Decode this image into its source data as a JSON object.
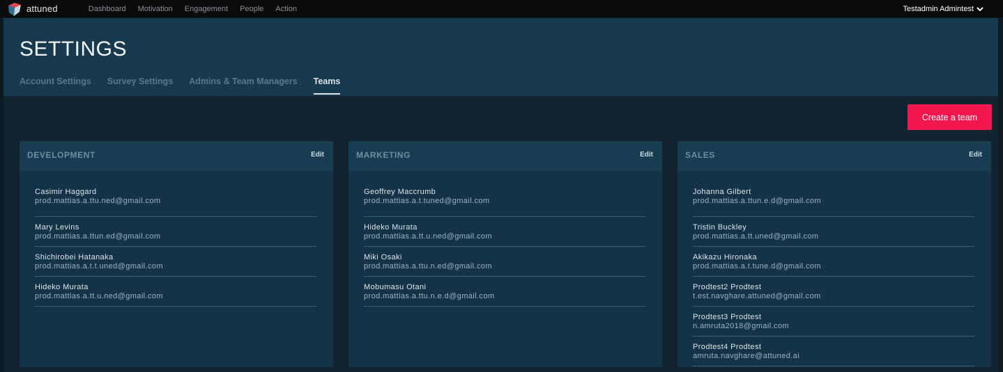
{
  "app": {
    "logo_text": "attuned"
  },
  "nav": [
    "Dashboard",
    "Motivation",
    "Engagement",
    "People",
    "Action"
  ],
  "user": {
    "name": "Testadmin Admintest"
  },
  "page": {
    "title": "SETTINGS"
  },
  "tabs": [
    "Account Settings",
    "Survey Settings",
    "Admins & Team Managers",
    "Teams"
  ],
  "active_tab": "Teams",
  "actions": {
    "create_team": "Create a team"
  },
  "edit_label": "Edit",
  "teams": [
    {
      "name": "DEVELOPMENT",
      "members": [
        {
          "name": "Casimir Haggard",
          "email": "prod.mattias.a.ttu.ned@gmail.com"
        },
        {
          "name": "Mary Levins",
          "email": "prod.mattias.a.ttun.ed@gmail.com"
        },
        {
          "name": "Shichirobei Hatanaka",
          "email": "prod.mattias.a.t.t.uned@gmail.com"
        },
        {
          "name": "Hideko Murata",
          "email": "prod.mattias.a.tt.u.ned@gmail.com"
        }
      ]
    },
    {
      "name": "MARKETING",
      "members": [
        {
          "name": "Geoffrey Maccrumb",
          "email": "prod.mattias.a.t.tuned@gmail.com"
        },
        {
          "name": "Hideko Murata",
          "email": "prod.mattias.a.tt.u.ned@gmail.com"
        },
        {
          "name": "Miki Osaki",
          "email": "prod.mattias.a.ttu.n.ed@gmail.com"
        },
        {
          "name": "Mobumasu Otani",
          "email": "prod.mattias.a.ttu.n.e.d@gmail.com"
        }
      ]
    },
    {
      "name": "SALES",
      "members": [
        {
          "name": "Johanna Gilbert",
          "email": "prod.mattias.a.ttun.e.d@gmail.com"
        },
        {
          "name": "Tristin Buckley",
          "email": "prod.mattias.a.tt.uned@gmail.com"
        },
        {
          "name": "Akikazu Hironaka",
          "email": "prod.mattias.a.t.tune.d@gmail.com"
        },
        {
          "name": "Prodtest2 Prodtest",
          "email": "t.est.navghare.attuned@gmail.com"
        },
        {
          "name": "Prodtest3 Prodtest",
          "email": "n.amruta2018@gmail.com"
        },
        {
          "name": "Prodtest4 Prodtest",
          "email": "amruta.navghare@attuned.ai"
        }
      ]
    }
  ],
  "colors": {
    "accent": "#f4174f",
    "header_bg": "#183a4e",
    "content_bg": "#10232f",
    "card_bg": "#153346"
  }
}
